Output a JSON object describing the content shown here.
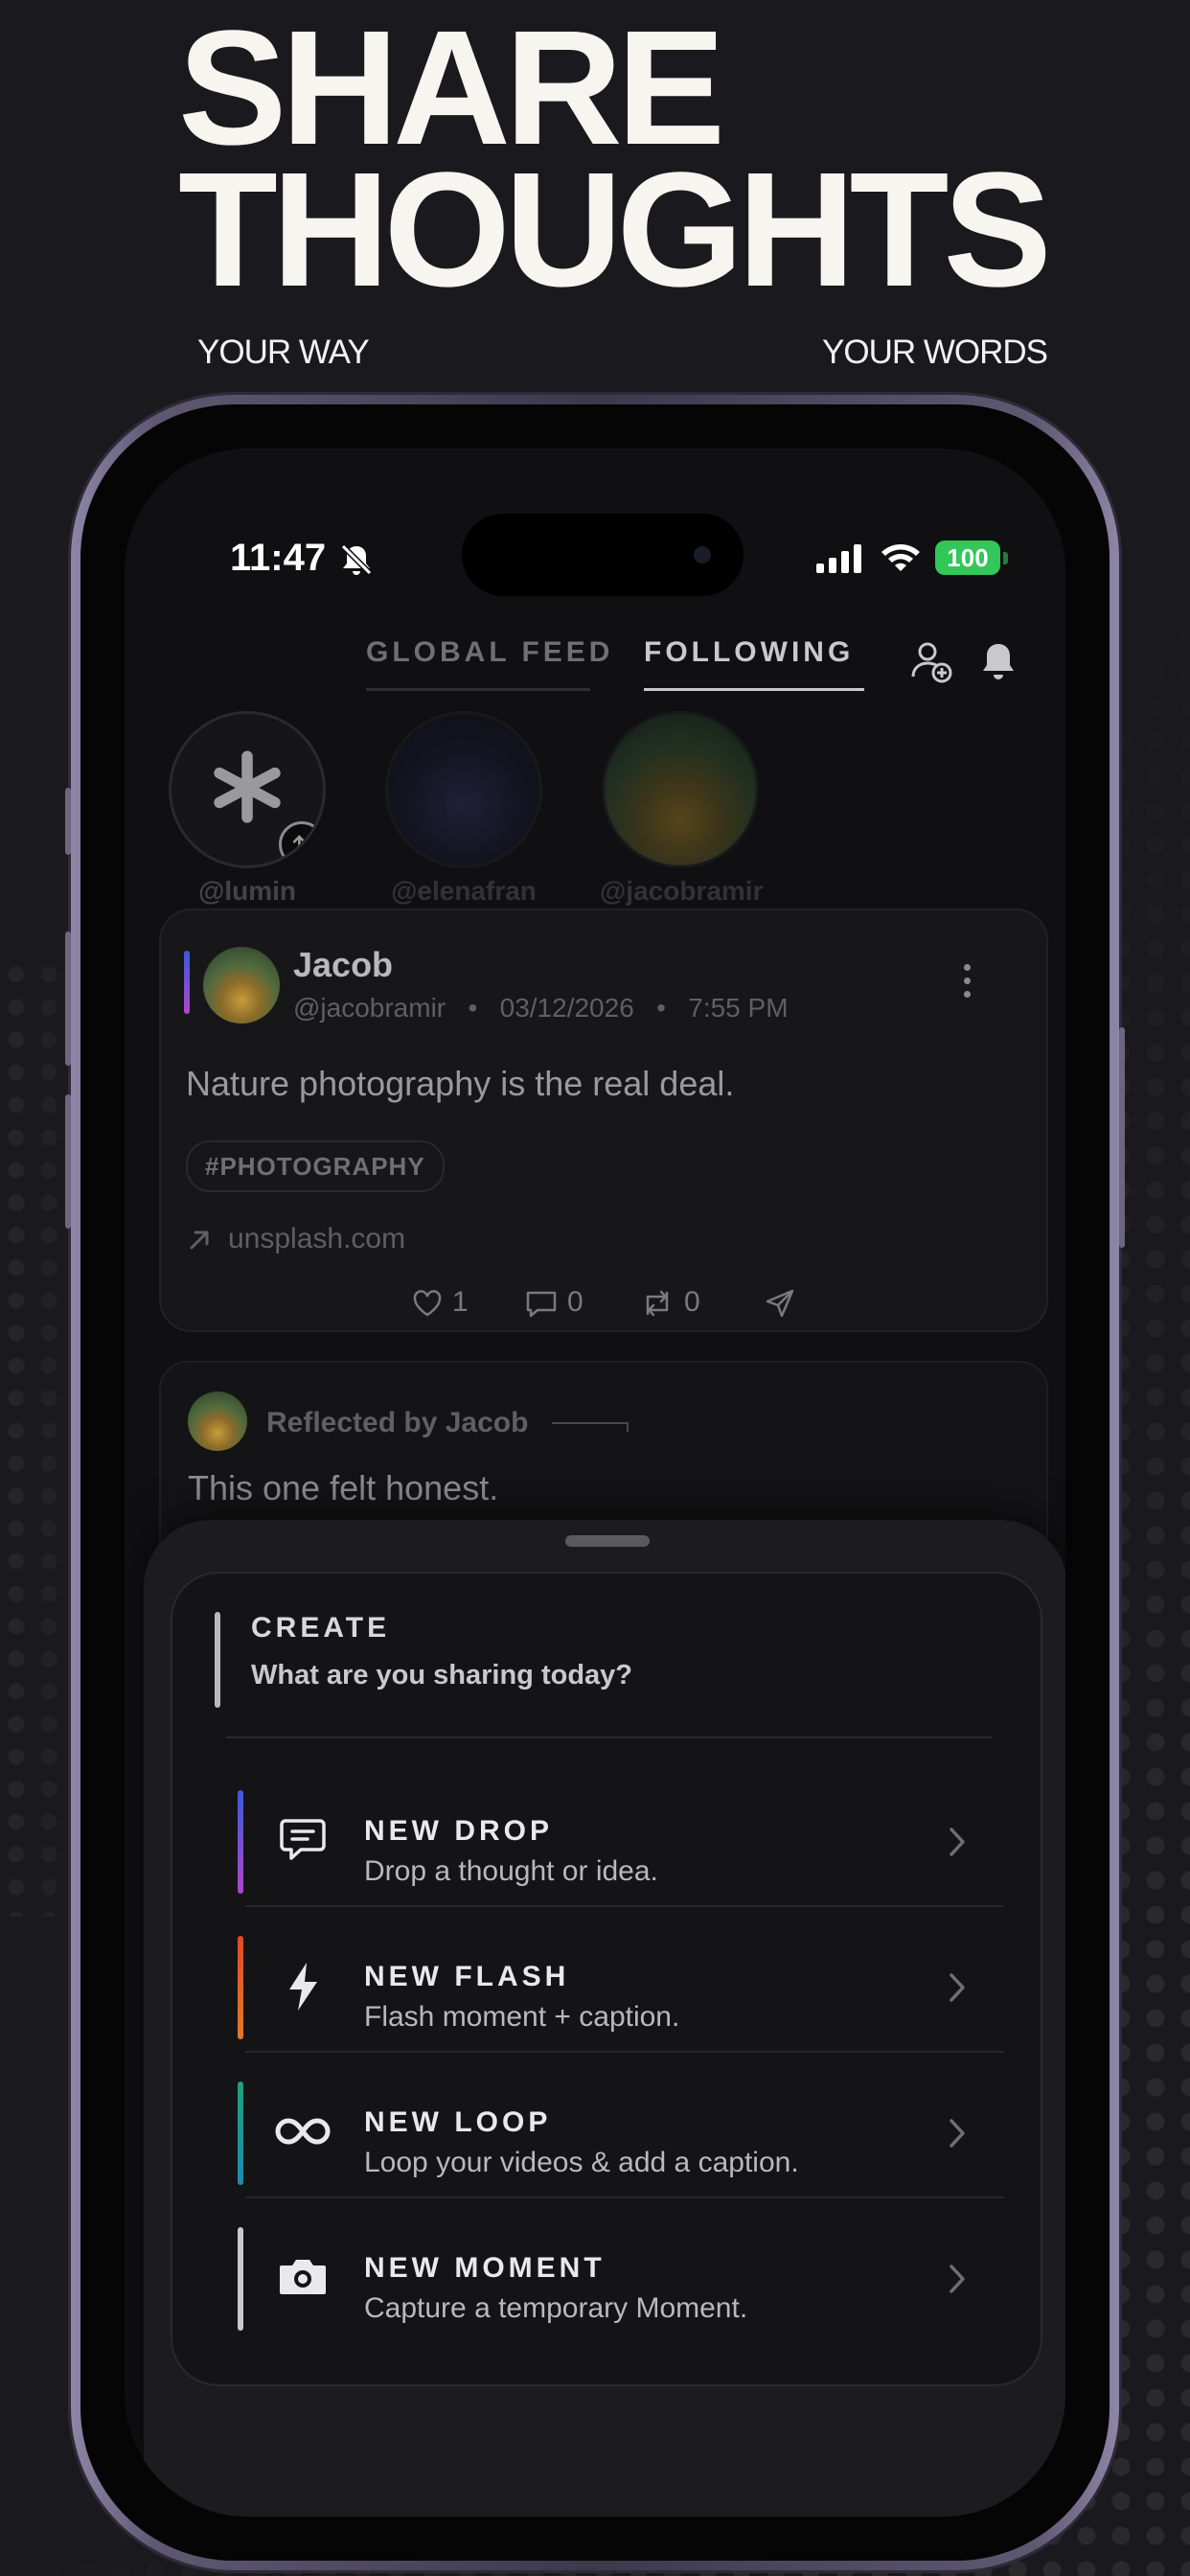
{
  "hero": {
    "line1": "SHARE",
    "line2": "THOUGHTS",
    "tag_left": "YOUR WAY",
    "tag_right": "YOUR WORDS"
  },
  "status_bar": {
    "time": "11:47",
    "battery": "100",
    "battery_color": "#31c759"
  },
  "feed_tabs": [
    {
      "label": "GLOBAL FEED",
      "active": false
    },
    {
      "label": "FOLLOWING",
      "active": true
    }
  ],
  "header_icons": [
    "add-user-icon",
    "bell-icon"
  ],
  "stories": [
    {
      "handle": "@lumin",
      "icon": "asterisk-icon"
    },
    {
      "handle": "@elenafran"
    },
    {
      "handle": "@jacobramir"
    }
  ],
  "post": {
    "author": "Jacob",
    "handle": "@jacobramir",
    "date": "03/12/2026",
    "time": "7:55 PM",
    "text": "Nature photography is the real deal.",
    "hashtag": "#PHOTOGRAPHY",
    "link": "unsplash.com",
    "likes": "1",
    "comments": "0",
    "reposts": "0"
  },
  "reflected_post": {
    "label": "Reflected by Jacob",
    "text": "This one felt honest."
  },
  "create_sheet": {
    "title": "CREATE",
    "subtitle": "What are you sharing today?",
    "options": [
      {
        "title": "NEW DROP",
        "desc": "Drop a thought or idea.",
        "icon": "message-icon",
        "accent": "#6d4bd8"
      },
      {
        "title": "NEW FLASH",
        "desc": "Flash moment + caption.",
        "icon": "lightning-icon",
        "accent": "#e0582a"
      },
      {
        "title": "NEW LOOP",
        "desc": "Loop your videos & add a caption.",
        "icon": "infinity-icon",
        "accent": "#1fa07a"
      },
      {
        "title": "NEW MOMENT",
        "desc": "Capture a temporary Moment.",
        "icon": "camera-icon",
        "accent": "#c9c9cc"
      }
    ]
  }
}
